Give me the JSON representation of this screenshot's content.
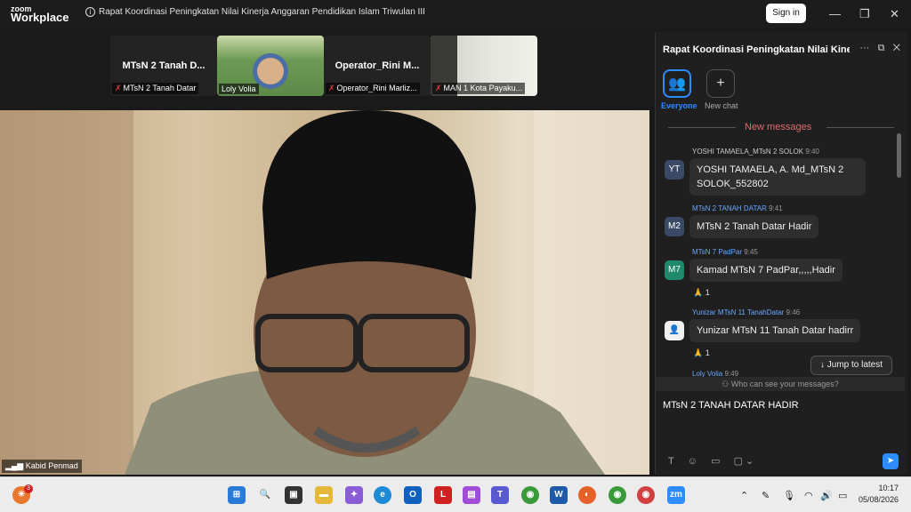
{
  "app": {
    "brand_top": "zoom",
    "brand_bottom": "Workplace"
  },
  "meeting": {
    "title": "Rapat Koordinasi Peningkatan Nilai Kinerja Anggaran Pendidikan Islam Triwulan III"
  },
  "titlebar": {
    "signin_label": "Sign in",
    "minimize": "—",
    "restore": "❐",
    "close": "✕"
  },
  "participants": [
    {
      "name": "MTsN 2 Tanah D...",
      "label": "MTsN 2 Tanah Datar",
      "muted": true
    },
    {
      "name": "",
      "label": "Loly Volia",
      "muted": false
    },
    {
      "name": "Operator_Rini  M...",
      "label": "Operator_Rini Marliz...",
      "muted": true
    },
    {
      "name": "",
      "label": "MAN 1 Kota Payaku...",
      "muted": true
    }
  ],
  "main_video": {
    "speaker_label": "Kabid Penmad"
  },
  "chat": {
    "title": "Rapat Koordinasi Peningkatan Nilai Kinerja...",
    "everyone_label": "Everyone",
    "newchat_label": "New chat",
    "new_messages_label": "New messages",
    "messages": [
      {
        "initials": "YT",
        "sender": "YOSHI TAMAELA_MTsN 2 SOLOK",
        "time": "9:40",
        "text": "YOSHI TAMAELA, A. Md_MTsN 2 SOLOK_552802",
        "reaction": "",
        "sender_color": "#cccccc"
      },
      {
        "initials": "M2",
        "sender": "MTsN 2 TANAH DATAR",
        "time": "9:41",
        "text": "MTsN 2 Tanah Datar Hadir",
        "reaction": "",
        "sender_color": "#6aa8ff"
      },
      {
        "initials": "M7",
        "sender": "MTsN 7 PadPar",
        "time": "9:45",
        "text": "Kamad MTsN 7 PadPar,,,,,Hadir",
        "reaction": "🙏 1",
        "sender_color": "#6aa8ff"
      },
      {
        "initials": "",
        "sender": "Yunizar MTsN 11 TanahDatar",
        "time": "9:46",
        "text": "Yunizar MTsN 11 Tanah Datar hadirr",
        "reaction": "🙏 1",
        "sender_color": "#6aa8ff"
      },
      {
        "initials": "",
        "sender": "Loly Volia",
        "time": "9:49",
        "text": "",
        "reaction": "",
        "sender_color": "#6aa8ff"
      }
    ],
    "jump_label": "↓ Jump to latest",
    "who_label": "Who can see your messages?",
    "input_value": "MTsN 2 TANAH DATAR HADIR"
  },
  "taskbar": {
    "notification_badge": "3",
    "time": "10:17",
    "date": "05/08/2026",
    "zoom_label": "zm"
  },
  "colors": {
    "accent": "#2d8cff",
    "muted": "#e03a3a"
  }
}
